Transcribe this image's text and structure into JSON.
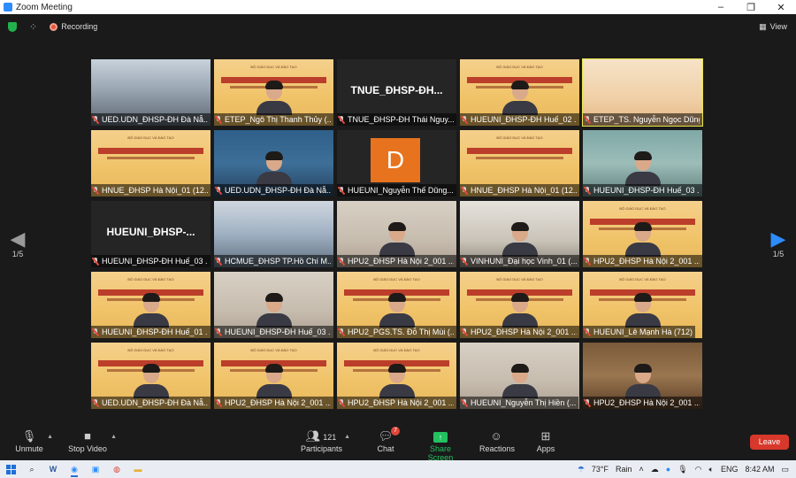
{
  "window": {
    "title": "Zoom Meeting",
    "controls": [
      "–",
      "❐",
      "✕"
    ]
  },
  "topbar": {
    "recording_label": "Recording",
    "view_label": "View"
  },
  "pager": {
    "left_label": "1/5",
    "right_label": "1/5"
  },
  "tiles": [
    {
      "name": "UED.UDN_ĐHSP-ĐH Đà Nẵ...",
      "bg": "conf"
    },
    {
      "name": "ETEP_Ngô Thị Thanh Thủy (...",
      "bg": "slide",
      "person": true
    },
    {
      "name": "TNUE_ĐHSP-ĐH Thái Nguy...",
      "bg": "dark",
      "big": "TNUE_ĐHSP-ĐH..."
    },
    {
      "name": "HUEUNI_ĐHSP-ĐH Huế_02 ...",
      "bg": "slide",
      "person": true
    },
    {
      "name": "ETEP_TS. Nguyễn Ngọc Dũng...",
      "bg": "podium",
      "active": true
    },
    {
      "name": "HNUE_ĐHSP Hà Nội_01 (12...",
      "bg": "slide"
    },
    {
      "name": "UED.UDN_ĐHSP-ĐH Đà Nẵ...",
      "bg": "blue",
      "person": true
    },
    {
      "name": "HUEUNI_Nguyễn Thế Dũng...",
      "bg": "dark",
      "avatar": "D"
    },
    {
      "name": "HNUE_ĐHSP Hà Nội_01 (12...",
      "bg": "slide"
    },
    {
      "name": "HUEUNI_ĐHSP-ĐH Huế_03 ...",
      "bg": "teal",
      "person": true
    },
    {
      "name": "HUEUNI_ĐHSP-ĐH Huế_03 ...",
      "bg": "dark",
      "big": "HUEUNI_ĐHSP-..."
    },
    {
      "name": "HCMUE_ĐHSP TP.Hồ Chí M...",
      "bg": "room"
    },
    {
      "name": "HPU2_ĐHSP Hà Nội 2_001 ...",
      "bg": "wall",
      "person": true
    },
    {
      "name": "VINHUNI_Đại học Vinh_01 (...",
      "bg": "office",
      "person": true
    },
    {
      "name": "HPU2_ĐHSP Hà Nội 2_001 ...",
      "bg": "slide",
      "person": true
    },
    {
      "name": "HUEUNI_ĐHSP-ĐH Huế_01 ...",
      "bg": "slide",
      "person": true
    },
    {
      "name": "HUEUNI_ĐHSP-ĐH Huế_03 ...",
      "bg": "wall",
      "person": true
    },
    {
      "name": "HPU2_PGS.TS. Đỗ Thị Mùi (...",
      "bg": "slide",
      "person": true
    },
    {
      "name": "HPU2_ĐHSP Hà Nội 2_001 ...",
      "bg": "slide",
      "person": true
    },
    {
      "name": "HUEUNI_Lê Mạnh Hà (712)",
      "bg": "slide",
      "person": true
    },
    {
      "name": "UED.UDN_ĐHSP-ĐH Đà Nẵ...",
      "bg": "slide",
      "person": true
    },
    {
      "name": "HPU2_ĐHSP Hà Nội 2_001 ...",
      "bg": "slide",
      "person": true
    },
    {
      "name": "HPU2_ĐHSP Hà Nội 2_001 ...",
      "bg": "slide",
      "person": true
    },
    {
      "name": "HUEUNI_Nguyễn Thị Hiền (...",
      "bg": "wall",
      "person": true
    },
    {
      "name": "HPU2_ĐHSP Hà Nội 2_001 ...",
      "bg": "shelf",
      "person": true
    }
  ],
  "slide_caption": "BỘ GIÁO DỤC VÀ ĐÀO TẠO",
  "toolbar": {
    "unmute": "Unmute",
    "stop_video": "Stop Video",
    "participants": "Participants",
    "participants_count": "121",
    "chat": "Chat",
    "chat_badge": "7",
    "share_screen": "Share Screen",
    "reactions": "Reactions",
    "apps": "Apps",
    "leave": "Leave"
  },
  "taskbar": {
    "weather": "73°F",
    "weather_desc": "Rain",
    "lang": "ENG",
    "time": "8:42 AM"
  },
  "colors": {
    "zoom_blue": "#2d8cff",
    "leave_red": "#d8382b",
    "share_green": "#23c160",
    "active_border": "#e9e64a"
  }
}
